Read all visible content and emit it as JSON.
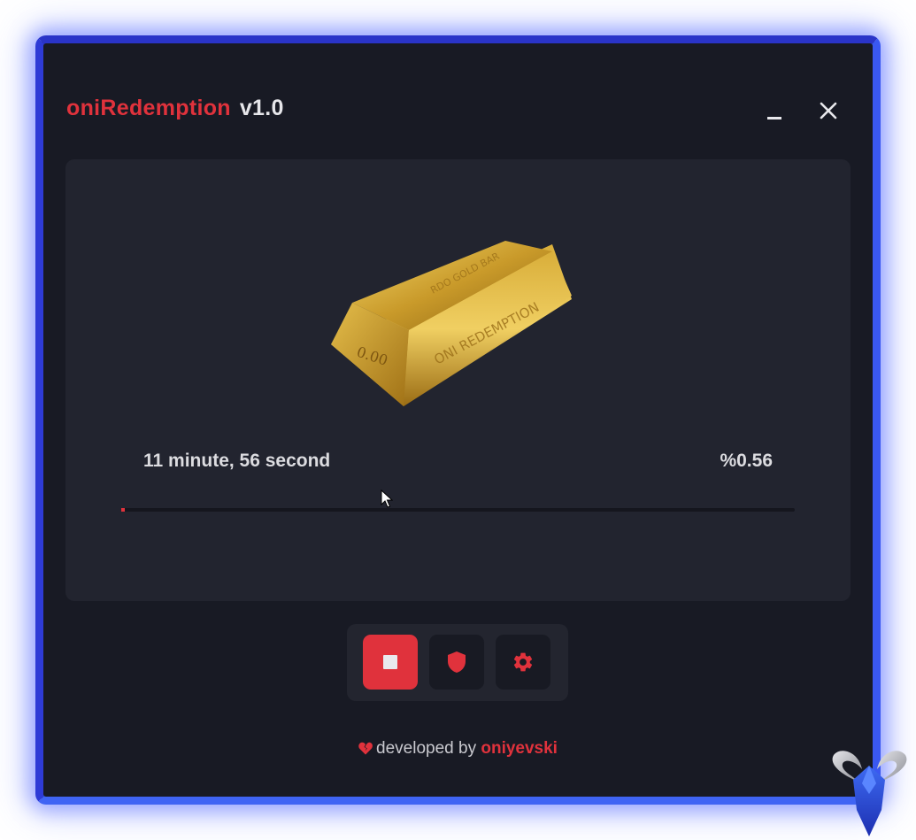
{
  "window": {
    "app_name": "oniRedemption",
    "version": "v1.0",
    "minimize_icon": "minimize-icon",
    "close_icon": "close-icon",
    "close_glyph": "✕"
  },
  "main": {
    "gold_bar": {
      "engraving_top": "RDO GOLD BAR",
      "engraving_side": "ONI REDEMPTION",
      "engraving_value": "0.00"
    },
    "elapsed": "11 minute, 56 second",
    "percent": "%0.56",
    "progress_fraction": 0.0056
  },
  "toolbar": {
    "stop_icon": "stop-icon",
    "shield_icon": "shield-icon",
    "settings_icon": "gear-icon"
  },
  "footer": {
    "heart_icon": "broken-heart-icon",
    "text": "developed by",
    "author": "oniyevski"
  },
  "colors": {
    "accent": "#e0323c",
    "window_border": "#3a4ff0",
    "background": "#181a24",
    "panel": "#22242f"
  }
}
